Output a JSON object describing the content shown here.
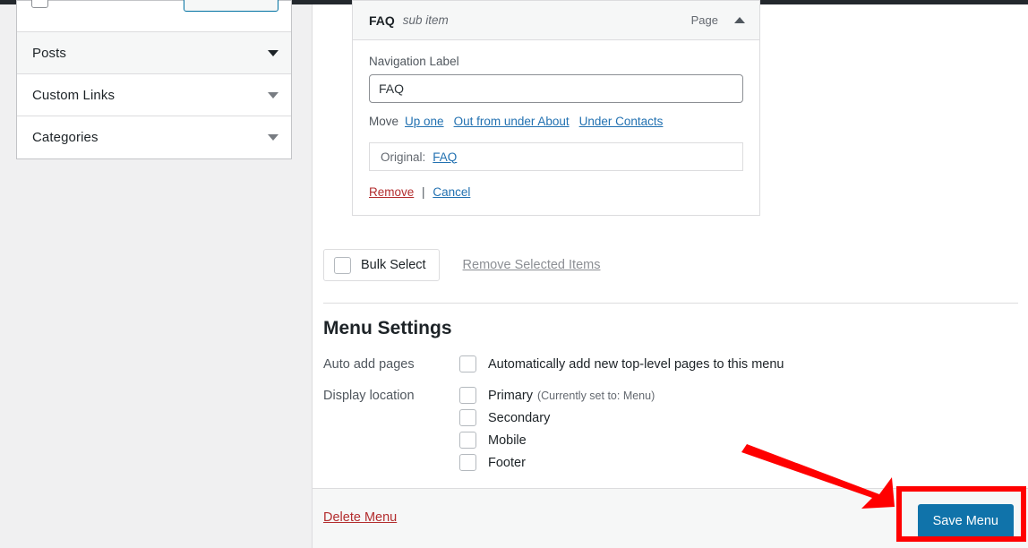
{
  "sidebar": {
    "panels": [
      {
        "label": "Posts",
        "icon": "chevron-down-icon",
        "active": true
      },
      {
        "label": "Custom Links",
        "icon": "chevron-down-icon",
        "active": false
      },
      {
        "label": "Categories",
        "icon": "chevron-down-icon",
        "active": false
      }
    ]
  },
  "menu_item": {
    "title": "FAQ",
    "subtitle": "sub item",
    "type": "Page",
    "toggle_icon": "chevron-up-icon",
    "nav_label_caption": "Navigation Label",
    "nav_label_value": "FAQ",
    "move": {
      "label": "Move",
      "links": [
        "Up one",
        "Out from under About",
        "Under Contacts"
      ]
    },
    "original": {
      "caption": "Original:",
      "value": "FAQ"
    },
    "remove_label": "Remove",
    "separator": "|",
    "cancel_label": "Cancel"
  },
  "bulk": {
    "select_label": "Bulk Select",
    "remove_selected_label": "Remove Selected Items"
  },
  "settings": {
    "heading": "Menu Settings",
    "auto_add": {
      "key": "Auto add pages",
      "option": "Automatically add new top-level pages to this menu",
      "checked": false
    },
    "display_location": {
      "key": "Display location",
      "options": [
        {
          "label": "Primary",
          "note": "(Currently set to: Menu)",
          "checked": false
        },
        {
          "label": "Secondary",
          "note": "",
          "checked": false
        },
        {
          "label": "Mobile",
          "note": "",
          "checked": false
        },
        {
          "label": "Footer",
          "note": "",
          "checked": false
        }
      ]
    }
  },
  "footer": {
    "delete_label": "Delete Menu",
    "save_label": "Save Menu"
  },
  "annotation": {
    "arrow_color": "#ff0000",
    "highlight_color": "#ff0000",
    "target": "Save Menu"
  },
  "colors": {
    "accent_blue": "#1073aa",
    "link_blue": "#2271b1",
    "danger_red": "#b32d2e",
    "admin_bar": "#23282d",
    "page_bg": "#f0f0f1"
  }
}
